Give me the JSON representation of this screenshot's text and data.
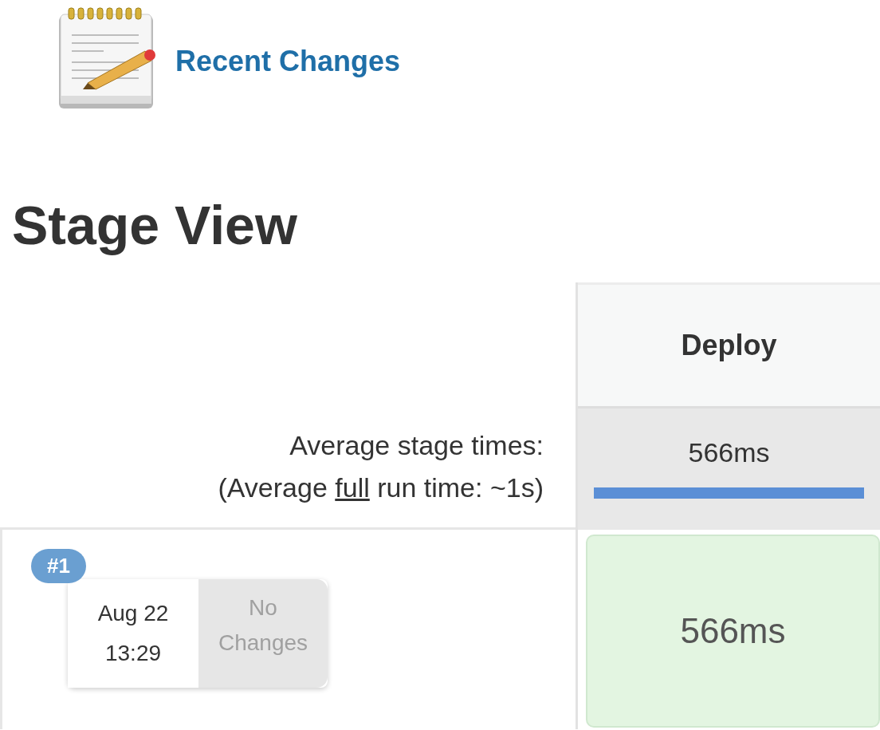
{
  "recent_changes": {
    "label": "Recent Changes"
  },
  "heading": "Stage View",
  "stages": [
    {
      "name": "Deploy",
      "average": "566ms"
    }
  ],
  "averages": {
    "label": "Average stage times:",
    "full_prefix": "(Average ",
    "full_link": "full",
    "full_suffix": " run time: ~1s)"
  },
  "builds": [
    {
      "number": "#1",
      "date": "Aug 22",
      "time": "13:29",
      "changes": "No Changes",
      "stages": [
        {
          "time": "566ms"
        }
      ]
    }
  ]
}
